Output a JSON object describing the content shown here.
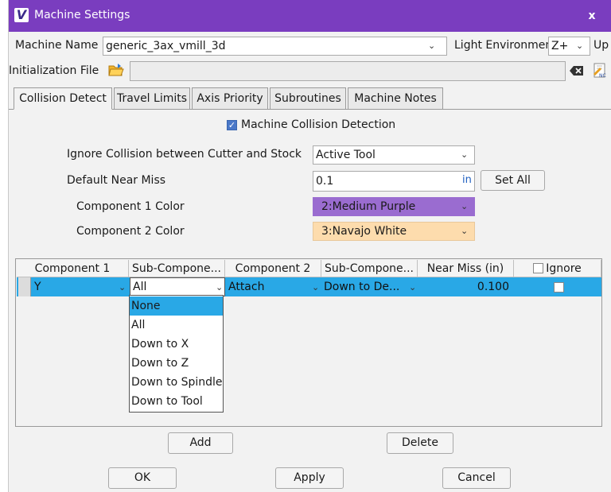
{
  "window": {
    "title": "Machine Settings",
    "close_glyph": "x",
    "logo_letter": "V"
  },
  "header": {
    "machine_name_label": "Machine Name",
    "machine_name_value": "generic_3ax_vmill_3d",
    "light_env_label": "Light Environment",
    "light_env_value": "Z+",
    "up_label": "Up",
    "init_file_label": "Initialization File",
    "init_file_value": ""
  },
  "tabs": [
    {
      "label": "Collision Detect",
      "active": true
    },
    {
      "label": "Travel Limits"
    },
    {
      "label": "Axis Priority"
    },
    {
      "label": "Subroutines"
    },
    {
      "label": "Machine Notes"
    }
  ],
  "collision": {
    "machine_collision_label": "Machine Collision Detection",
    "machine_collision_checked": true,
    "ignore_label": "Ignore Collision between Cutter and Stock",
    "ignore_value": "Active Tool",
    "near_miss_label": "Default Near Miss",
    "near_miss_value": "0.1",
    "near_miss_unit": "in",
    "set_all_label": "Set All",
    "comp1_color_label": "Component 1 Color",
    "comp1_color_value": "2:Medium Purple",
    "comp1_color_hex": "#9a6cd0",
    "comp2_color_label": "Component 2 Color",
    "comp2_color_value": "3:Navajo White",
    "comp2_color_hex": "#fddcad"
  },
  "table": {
    "headers": [
      "Component 1",
      "Sub-Compone...",
      "Component 2",
      "Sub-Compone...",
      "Near Miss (in)",
      "Ignore"
    ],
    "rows": [
      {
        "component1": "Y",
        "sub1": "All",
        "component2": "Attach",
        "sub2": "Down to De...",
        "near_miss": "0.100",
        "ignore": false
      }
    ]
  },
  "dropdown": {
    "options": [
      "None",
      "All",
      "Down to X",
      "Down to Z",
      "Down to Spindle",
      "Down to Tool"
    ],
    "highlighted": "None"
  },
  "buttons": {
    "add": "Add",
    "delete": "Delete",
    "ok": "OK",
    "apply": "Apply",
    "cancel": "Cancel"
  }
}
